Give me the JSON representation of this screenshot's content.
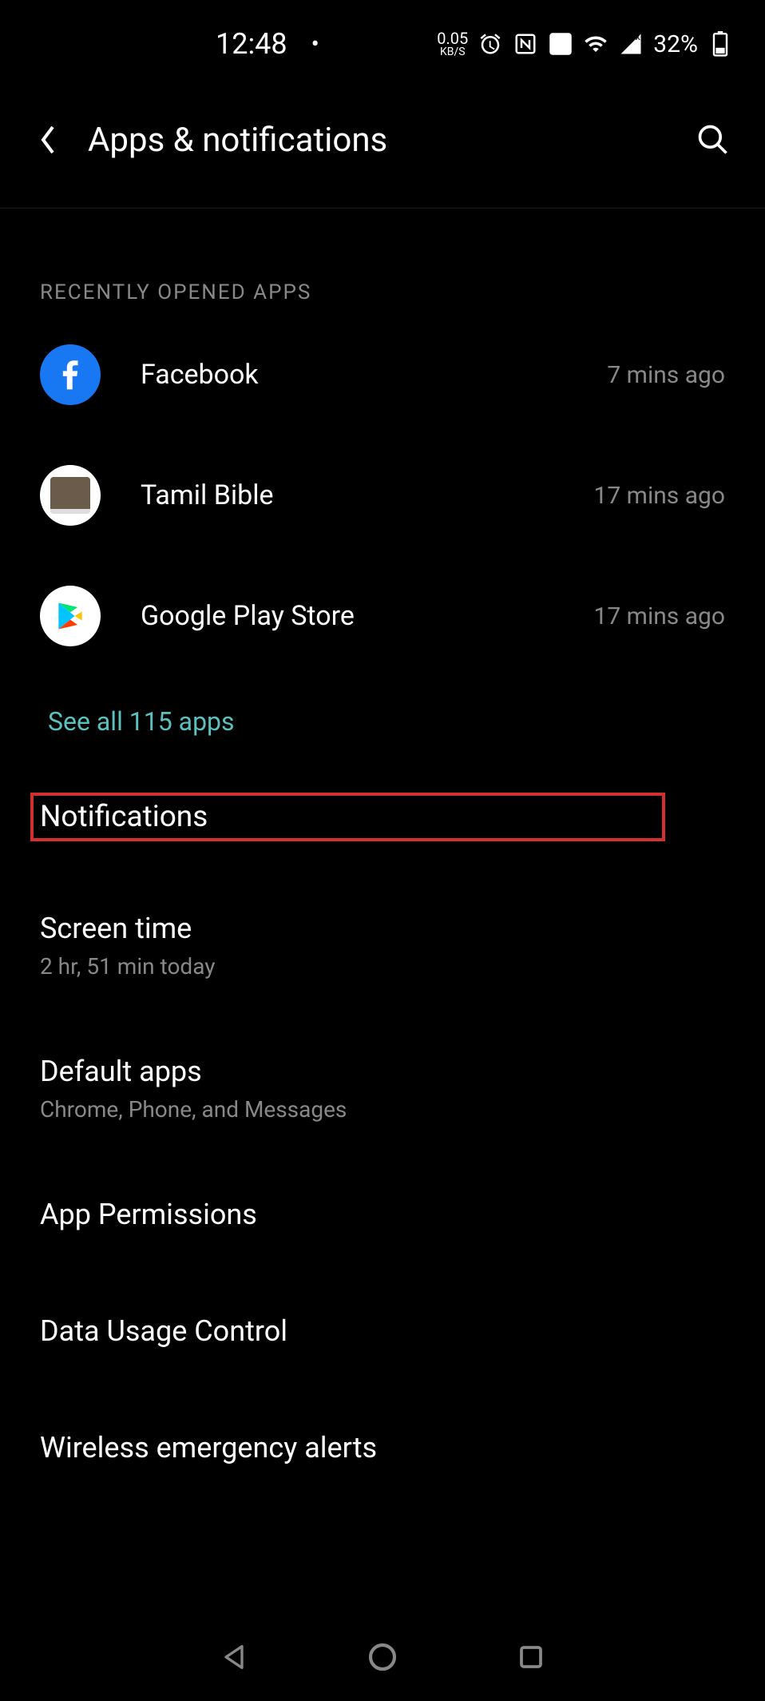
{
  "statusbar": {
    "time": "12:48",
    "dot": "•",
    "net_speed_value": "0.05",
    "net_speed_unit": "KB/S",
    "battery_pct": "32%"
  },
  "header": {
    "title": "Apps & notifications"
  },
  "section_label": "RECENTLY OPENED APPS",
  "recent_apps": [
    {
      "name": "Facebook",
      "time": "7 mins ago"
    },
    {
      "name": "Tamil Bible",
      "time": "17 mins ago"
    },
    {
      "name": "Google Play Store",
      "time": "17 mins ago"
    }
  ],
  "see_all": "See all 115 apps",
  "settings": {
    "notifications": {
      "title": "Notifications"
    },
    "screen_time": {
      "title": "Screen time",
      "subtitle": "2 hr, 51 min today"
    },
    "default_apps": {
      "title": "Default apps",
      "subtitle": "Chrome, Phone, and Messages"
    },
    "app_permissions": {
      "title": "App Permissions"
    },
    "data_usage": {
      "title": "Data Usage Control"
    },
    "emergency_alerts": {
      "title": "Wireless emergency alerts"
    }
  }
}
